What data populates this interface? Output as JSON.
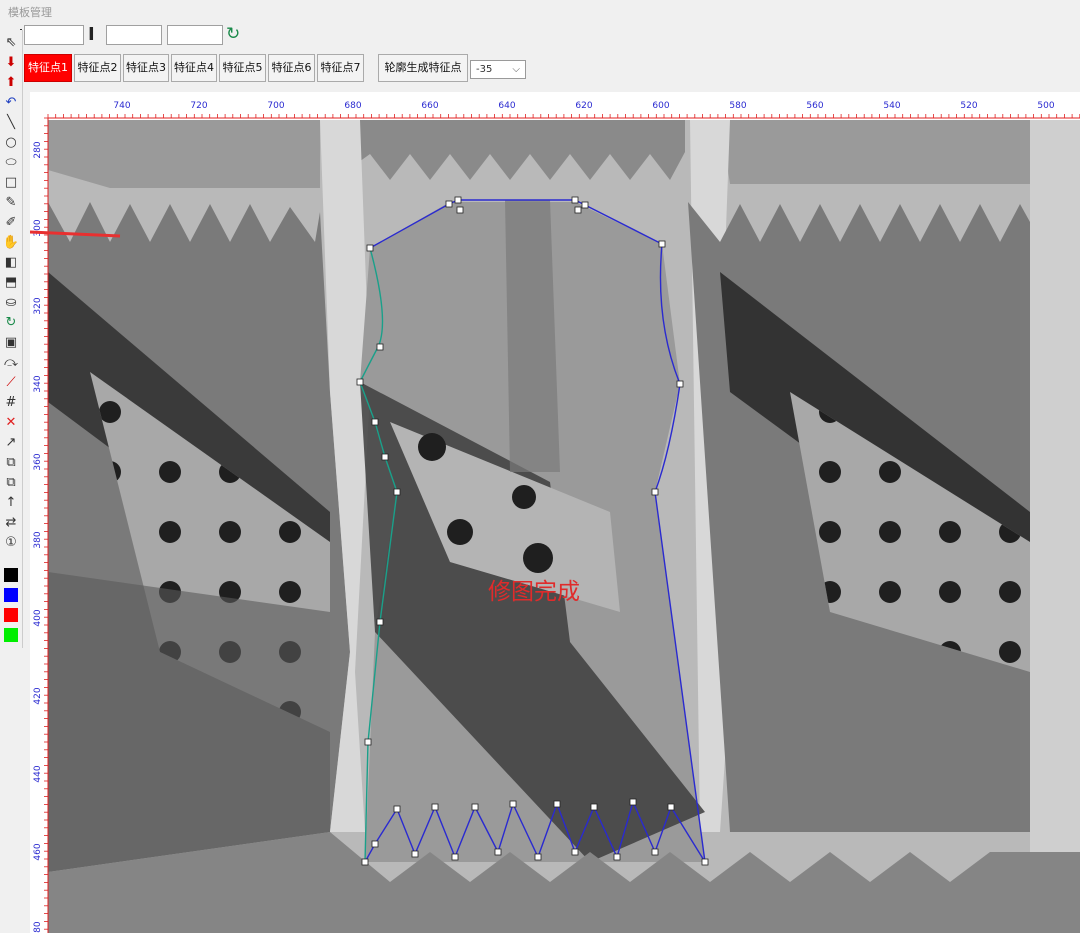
{
  "window": {
    "title": "模板管理"
  },
  "top_inputs": {
    "field1": "",
    "field2": "",
    "field3": ""
  },
  "feature_buttons": [
    {
      "label": "特征点1",
      "active": true
    },
    {
      "label": "特征点2",
      "active": false
    },
    {
      "label": "特征点3",
      "active": false
    },
    {
      "label": "特征点4",
      "active": false
    },
    {
      "label": "特征点5",
      "active": false
    },
    {
      "label": "特征点6",
      "active": false
    },
    {
      "label": "特征点7",
      "active": false
    }
  ],
  "generate_button": "轮廓生成特征点",
  "angle_select": {
    "value": "-35"
  },
  "ruler": {
    "x_labels": [
      "740",
      "720",
      "700",
      "680",
      "660",
      "640",
      "620",
      "600",
      "580",
      "560",
      "540",
      "520",
      "500"
    ],
    "y_labels": [
      "280",
      "300",
      "320",
      "340",
      "360",
      "380",
      "400",
      "420",
      "440",
      "460",
      "480"
    ]
  },
  "status_text": "修图完成",
  "colors": {
    "active": "#ff0000",
    "contour": "#2a2ad0",
    "contour_edge": "#1aa08a",
    "ruler": "#e02020",
    "status": "#e02b2b"
  },
  "toolbar_icons": [
    "pointer-icon",
    "import-icon",
    "export-icon",
    "undo-icon",
    "line-icon",
    "circle-icon",
    "ellipse-icon",
    "rectangle-icon",
    "pen-icon",
    "edit-pen-icon",
    "hand-icon",
    "mirror-v-icon",
    "mirror-h-icon",
    "fill-icon",
    "rotate-icon",
    "crop-icon",
    "arc-icon",
    "cut-line-icon",
    "grid-icon",
    "delete-icon",
    "move-point-icon",
    "copy-icon",
    "delete-copy-icon",
    "arrow-up-icon",
    "swap-icon",
    "number-one-icon",
    "color-black",
    "color-blue",
    "color-red",
    "color-green"
  ]
}
